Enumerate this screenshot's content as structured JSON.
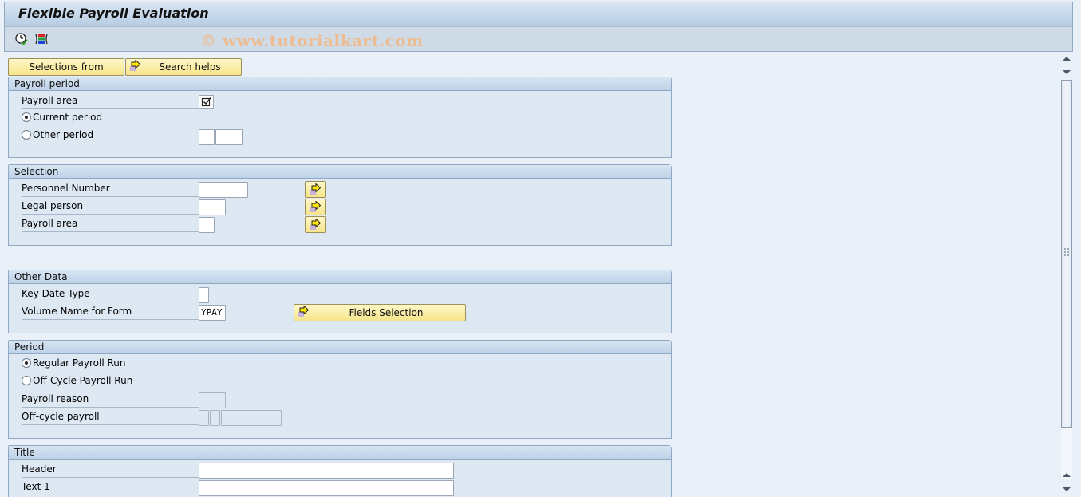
{
  "window": {
    "title": "Flexible Payroll Evaluation",
    "watermark": "© www.tutorialkart.com"
  },
  "toolbar": {
    "icons": [
      "execute-icon",
      "selection-options-icon"
    ]
  },
  "buttons": {
    "selections_from": "Selections from",
    "search_helps": "Search helps",
    "fields_selection": "Fields Selection"
  },
  "groups": {
    "payroll_period": {
      "title": "Payroll period",
      "payroll_area_label": "Payroll area",
      "payroll_area_checked": true,
      "current_period_label": "Current period",
      "other_period_label": "Other period",
      "selected": "current_period",
      "other_period_value_1": "",
      "other_period_value_2": ""
    },
    "selection": {
      "title": "Selection",
      "personnel_number_label": "Personnel Number",
      "personnel_number_value": "",
      "legal_person_label": "Legal person",
      "legal_person_value": "",
      "payroll_area_label": "Payroll area",
      "payroll_area_value": ""
    },
    "other_data": {
      "title": "Other Data",
      "key_date_type_label": "Key Date Type",
      "key_date_type_value": "",
      "volume_name_label": "Volume Name for Form",
      "volume_name_value": "YPAY"
    },
    "period": {
      "title": "Period",
      "regular_run_label": "Regular Payroll Run",
      "offcycle_run_label": "Off-Cycle Payroll Run",
      "selected": "regular",
      "payroll_reason_label": "Payroll reason",
      "payroll_reason_value": "",
      "offcycle_payroll_label": "Off-cycle payroll",
      "offcycle_payroll_values": [
        "",
        "",
        ""
      ]
    },
    "title": {
      "title": "Title",
      "header_label": "Header",
      "header_value": "",
      "text1_label": "Text 1",
      "text1_value": ""
    }
  }
}
